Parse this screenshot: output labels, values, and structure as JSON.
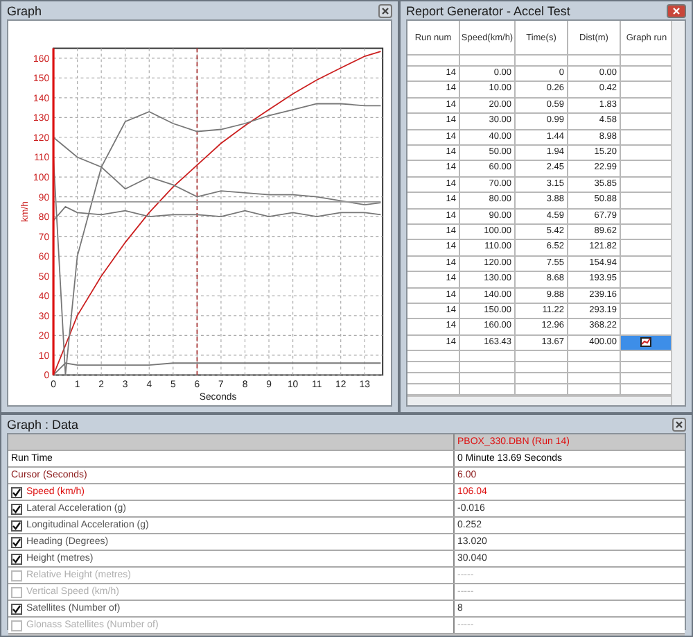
{
  "graph_window": {
    "title": "Graph",
    "chart_data": {
      "type": "line",
      "xlabel": "Seconds",
      "ylabel": "km/h",
      "x": [
        0,
        0.5,
        1,
        2,
        3,
        4,
        5,
        6,
        7,
        8,
        9,
        10,
        11,
        12,
        13,
        13.67
      ],
      "series": [
        {
          "color": "#cc2020",
          "values": [
            0,
            15,
            30,
            50,
            67,
            82,
            95,
            106,
            117,
            126,
            134,
            142,
            149,
            155,
            161,
            163.4
          ]
        },
        {
          "color": "#777777",
          "values": [
            110,
            0,
            60,
            105,
            128,
            133,
            127,
            123,
            124,
            127,
            131,
            134,
            137,
            137,
            136,
            136
          ]
        },
        {
          "color": "#777777",
          "values": [
            120,
            115,
            110,
            105,
            94,
            100,
            96,
            90,
            93,
            92,
            91,
            91,
            90,
            88,
            86,
            87
          ]
        },
        {
          "color": "#777777",
          "values": [
            78,
            85,
            82,
            81,
            83,
            80,
            81,
            81,
            80,
            83,
            80,
            82,
            80,
            82,
            82,
            81
          ]
        },
        {
          "color": "#999999",
          "values": [
            87.5,
            87.5,
            87.5,
            87.5,
            87.5,
            87.5,
            87.5,
            87.5,
            87.5,
            87.5,
            87.5,
            87.5,
            87.5,
            87.5,
            87.5,
            87.5
          ]
        },
        {
          "color": "#777777",
          "values": [
            0,
            6,
            5,
            5,
            5,
            5,
            6,
            6,
            6,
            6,
            6,
            6,
            6,
            6,
            6,
            6
          ]
        }
      ],
      "xlim": [
        0,
        13.75
      ],
      "ylim": [
        0,
        165
      ],
      "xticks": [
        0,
        1,
        2,
        3,
        4,
        5,
        6,
        7,
        8,
        9,
        10,
        11,
        12,
        13
      ],
      "yticks": [
        0,
        10,
        20,
        30,
        40,
        50,
        60,
        70,
        80,
        90,
        100,
        110,
        120,
        130,
        140,
        150,
        160
      ],
      "grid": true,
      "ref_lines": [
        {
          "axis": "x",
          "value": 6
        }
      ]
    }
  },
  "report_window": {
    "title": "Report Generator - Accel Test",
    "columns": [
      "Run num",
      "Speed(km/h)",
      "Time(s)",
      "Dist(m)",
      "Graph run"
    ],
    "rows": [
      {
        "cells": [
          "14",
          "0.00",
          "0",
          "0.00"
        ],
        "selected": false
      },
      {
        "cells": [
          "14",
          "10.00",
          "0.26",
          "0.42"
        ],
        "selected": false
      },
      {
        "cells": [
          "14",
          "20.00",
          "0.59",
          "1.83"
        ],
        "selected": false
      },
      {
        "cells": [
          "14",
          "30.00",
          "0.99",
          "4.58"
        ],
        "selected": false
      },
      {
        "cells": [
          "14",
          "40.00",
          "1.44",
          "8.98"
        ],
        "selected": false
      },
      {
        "cells": [
          "14",
          "50.00",
          "1.94",
          "15.20"
        ],
        "selected": false
      },
      {
        "cells": [
          "14",
          "60.00",
          "2.45",
          "22.99"
        ],
        "selected": false
      },
      {
        "cells": [
          "14",
          "70.00",
          "3.15",
          "35.85"
        ],
        "selected": false
      },
      {
        "cells": [
          "14",
          "80.00",
          "3.88",
          "50.88"
        ],
        "selected": false
      },
      {
        "cells": [
          "14",
          "90.00",
          "4.59",
          "67.79"
        ],
        "selected": false
      },
      {
        "cells": [
          "14",
          "100.00",
          "5.42",
          "89.62"
        ],
        "selected": false
      },
      {
        "cells": [
          "14",
          "110.00",
          "6.52",
          "121.82"
        ],
        "selected": false
      },
      {
        "cells": [
          "14",
          "120.00",
          "7.55",
          "154.94"
        ],
        "selected": false
      },
      {
        "cells": [
          "14",
          "130.00",
          "8.68",
          "193.95"
        ],
        "selected": false
      },
      {
        "cells": [
          "14",
          "140.00",
          "9.88",
          "239.16"
        ],
        "selected": false
      },
      {
        "cells": [
          "14",
          "150.00",
          "11.22",
          "293.19"
        ],
        "selected": false
      },
      {
        "cells": [
          "14",
          "160.00",
          "12.96",
          "368.22"
        ],
        "selected": false
      },
      {
        "cells": [
          "14",
          "163.43",
          "13.67",
          "400.00"
        ],
        "selected": true
      }
    ]
  },
  "data_window": {
    "title": "Graph : Data",
    "file": "PBOX_330.DBN (Run 14)",
    "rows": [
      {
        "kind": "plain",
        "label": "Run Time",
        "value": "0 Minute 13.69 Seconds",
        "color": "#000000"
      },
      {
        "kind": "plain",
        "label": "Cursor (Seconds)",
        "value": "6.00",
        "color": "#8b1a1a"
      },
      {
        "kind": "check",
        "label": "Speed (km/h)",
        "value": "106.04",
        "checked": true,
        "disabled": false,
        "color": "#dd1111"
      },
      {
        "kind": "check",
        "label": "Lateral Acceleration (g)",
        "value": "-0.016",
        "checked": true,
        "disabled": false,
        "color": "#555555"
      },
      {
        "kind": "check",
        "label": "Longitudinal Acceleration (g)",
        "value": "0.252",
        "checked": true,
        "disabled": false,
        "color": "#555555"
      },
      {
        "kind": "check",
        "label": "Heading (Degrees)",
        "value": "13.020",
        "checked": true,
        "disabled": false,
        "color": "#555555"
      },
      {
        "kind": "check",
        "label": "Height (metres)",
        "value": "30.040",
        "checked": true,
        "disabled": false,
        "color": "#555555"
      },
      {
        "kind": "check",
        "label": "Relative Height (metres)",
        "value": "-----",
        "checked": false,
        "disabled": true,
        "color": "#b0b0b0"
      },
      {
        "kind": "check",
        "label": "Vertical Speed (km/h)",
        "value": "-----",
        "checked": false,
        "disabled": true,
        "color": "#b0b0b0"
      },
      {
        "kind": "check",
        "label": "Satellites (Number of)",
        "value": "8",
        "checked": true,
        "disabled": false,
        "color": "#555555"
      },
      {
        "kind": "check",
        "label": "Glonass Satellites (Number of)",
        "value": "-----",
        "checked": false,
        "disabled": true,
        "color": "#b0b0b0"
      }
    ]
  }
}
